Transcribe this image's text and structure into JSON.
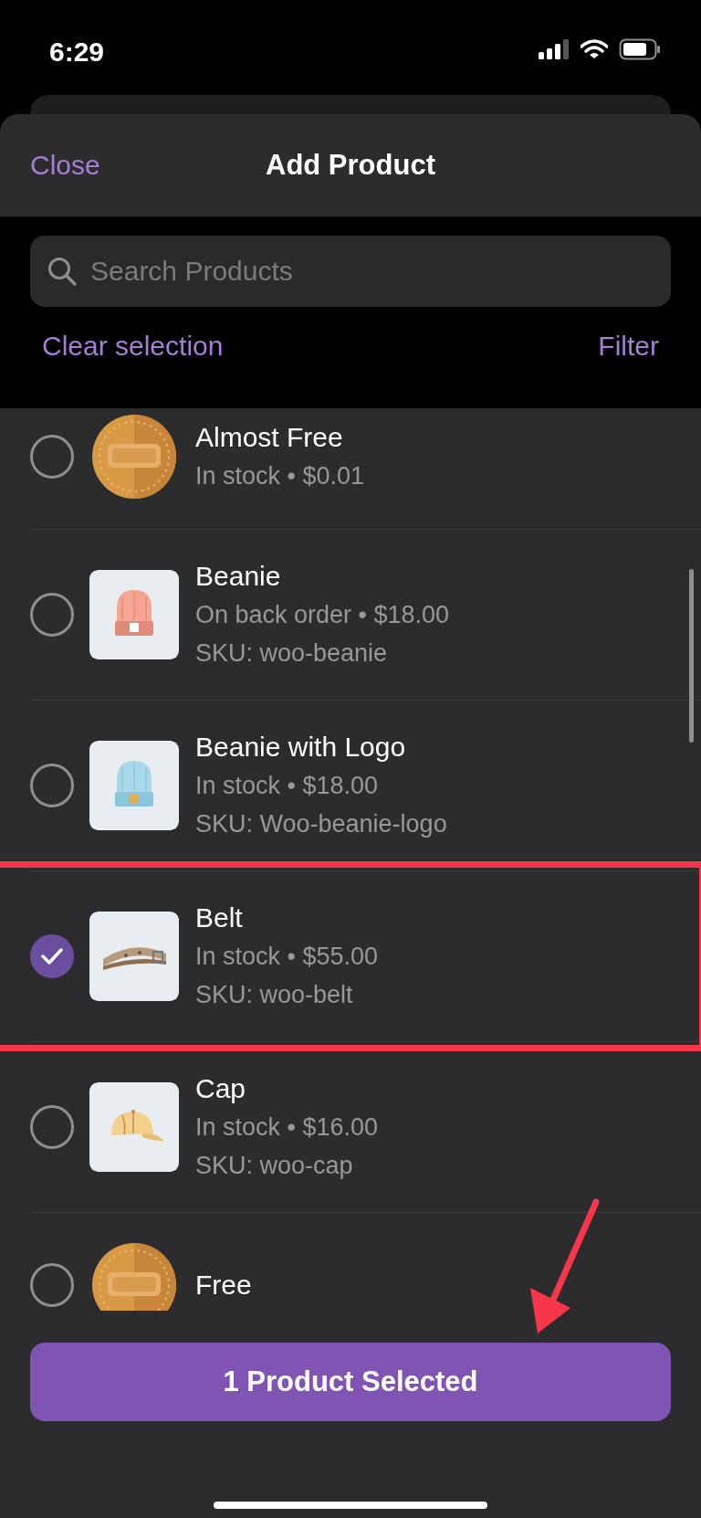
{
  "status_bar": {
    "time": "6:29"
  },
  "header": {
    "close": "Close",
    "title": "Add Product"
  },
  "search": {
    "placeholder": "Search Products"
  },
  "toolbar": {
    "clear": "Clear selection",
    "filter": "Filter"
  },
  "products": [
    {
      "name": "Almost Free",
      "details": "In stock • $0.01",
      "kind": "coin",
      "selected": false,
      "highlighted": false
    },
    {
      "name": "Beanie",
      "details": "On back order • $18.00",
      "sku": "SKU: woo-beanie",
      "selected": false,
      "highlighted": false
    },
    {
      "name": "Beanie with Logo",
      "details": "In stock • $18.00",
      "sku": "SKU: Woo-beanie-logo",
      "selected": false,
      "highlighted": false
    },
    {
      "name": "Belt",
      "details": "In stock • $55.00",
      "sku": "SKU: woo-belt",
      "selected": true,
      "highlighted": true
    },
    {
      "name": "Cap",
      "details": "In stock • $16.00",
      "sku": "SKU: woo-cap",
      "selected": false,
      "highlighted": false
    },
    {
      "name": "Free",
      "kind": "coin",
      "selected": false,
      "highlighted": false
    }
  ],
  "primary_button": {
    "label": "1 Product Selected",
    "pointed_at": true
  }
}
